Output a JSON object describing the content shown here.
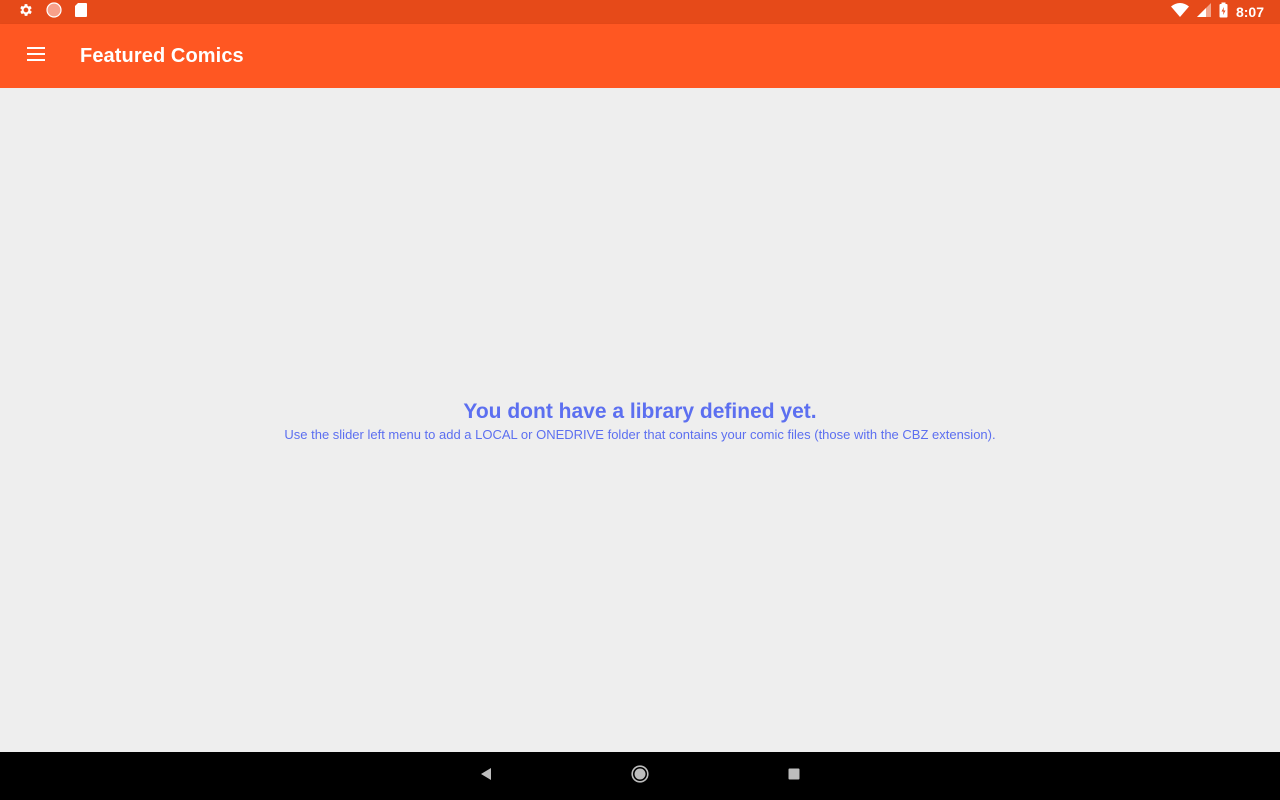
{
  "status_bar": {
    "left_icons": [
      "settings-icon",
      "record-icon",
      "sd-card-icon"
    ],
    "right_icons": [
      "wifi-icon",
      "cell-signal-icon",
      "battery-charging-icon"
    ],
    "time": "8:07",
    "color": "#e64a19"
  },
  "app_bar": {
    "title": "Featured Comics",
    "menu_icon": "hamburger-menu-icon",
    "color": "#ff5722"
  },
  "empty_state": {
    "title": "You dont have a library defined yet.",
    "subtitle": "Use the slider left menu to add a LOCAL or ONEDRIVE folder that contains your comic files (those with the CBZ extension).",
    "text_color": "#5c6ff0"
  },
  "nav_bar": {
    "buttons": [
      "back-icon",
      "home-icon",
      "recents-icon"
    ]
  }
}
